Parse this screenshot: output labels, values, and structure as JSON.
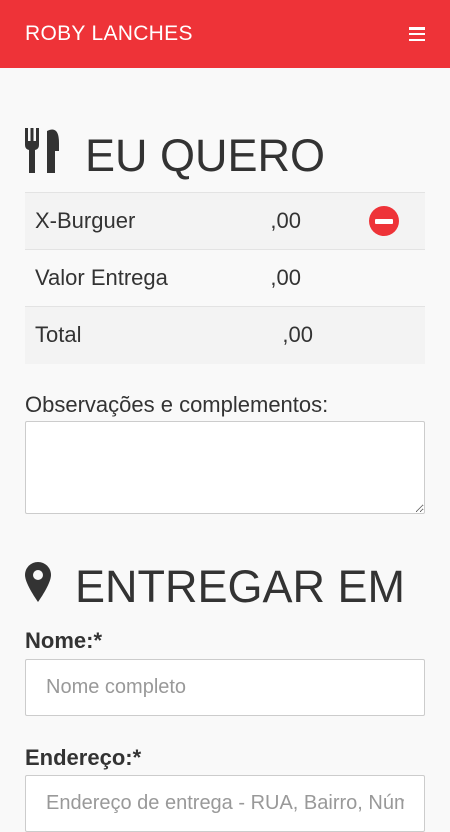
{
  "header": {
    "brand": "ROBY LANCHES",
    "menu_icon": "hamburger-menu-icon",
    "background": "#ee3338"
  },
  "order": {
    "title": "EU QUERO",
    "title_icon": "utensils-icon",
    "items": [
      {
        "name": "X-Burguer",
        "price": ",00",
        "removable": true
      },
      {
        "name": "Valor Entrega",
        "price": ",00",
        "removable": false
      },
      {
        "name": "Total",
        "price": ",00",
        "removable": false
      }
    ],
    "remove_icon": "minus-circle-icon",
    "observations_label": "Observações e complementos:",
    "observations_value": ""
  },
  "delivery": {
    "title": "ENTREGAR EM",
    "title_icon": "map-marker-icon",
    "name_label": "Nome:*",
    "name_placeholder": "Nome completo",
    "address_label": "Endereço:*",
    "address_placeholder": "Endereço de entrega - RUA, Bairro, Número"
  }
}
